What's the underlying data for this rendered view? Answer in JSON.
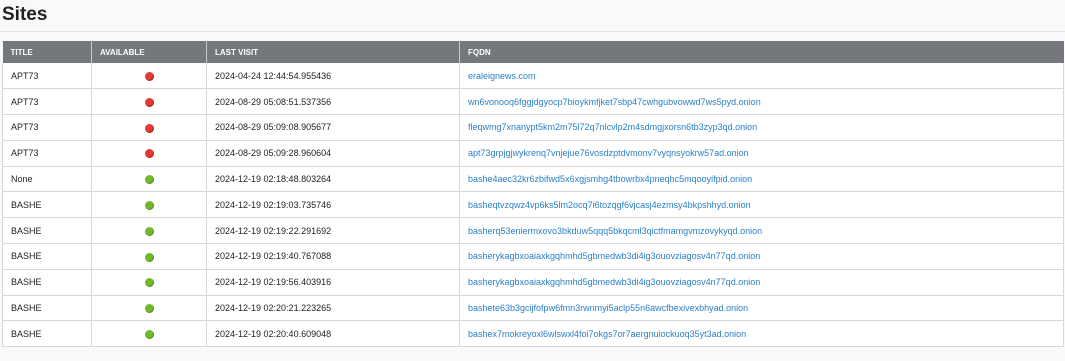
{
  "page": {
    "title": "Sites"
  },
  "table": {
    "columns": [
      "TITLE",
      "AVAILABLE",
      "LAST VISIT",
      "FQDN"
    ],
    "rows": [
      {
        "title": "APT73",
        "available": false,
        "last_visit": "2024-04-24 12:44:54.955436",
        "fqdn": "eraleignews.com"
      },
      {
        "title": "APT73",
        "available": false,
        "last_visit": "2024-08-29 05:08:51.537356",
        "fqdn": "wn6vonooq6fggjdgyocp7bioykmfjket7sbp47cwhgubvowwd7ws5pyd.onion"
      },
      {
        "title": "APT73",
        "available": false,
        "last_visit": "2024-08-29 05:09:08.905677",
        "fqdn": "fleqwmg7xnanypt5km2m75l72q7nlcvlp2m4sdmgjxorsn6tb3zyp3qd.onion"
      },
      {
        "title": "APT73",
        "available": false,
        "last_visit": "2024-08-29 05:09:28.960604",
        "fqdn": "apt73grpjgjwykrenq7vnjejue76vosdzptdvmonv7vyqnsyokrw57ad.onion"
      },
      {
        "title": "None",
        "available": true,
        "last_visit": "2024-12-19 02:18:48.803264",
        "fqdn": "bashe4aec32kr6zbifwd5x6xgjsmhg4tbowrbx4pneqhc5mqooyifpid.onion"
      },
      {
        "title": "BASHE",
        "available": true,
        "last_visit": "2024-12-19 02:19:03.735746",
        "fqdn": "basheqtvzqwz4vp6ks5lm2ocq7i6tozqgf6vjcasj4ezmsy4bkpshhyd.onion"
      },
      {
        "title": "BASHE",
        "available": true,
        "last_visit": "2024-12-19 02:19:22.291692",
        "fqdn": "basherq53eniermxovo3bkduw5qqq5bkqcml3qictfmamgvmzovykyqd.onion"
      },
      {
        "title": "BASHE",
        "available": true,
        "last_visit": "2024-12-19 02:19:40.767088",
        "fqdn": "basherykagbxoaiaxkgqhmhd5gbmedwb3di4ig3ouovziagosv4n77qd.onion"
      },
      {
        "title": "BASHE",
        "available": true,
        "last_visit": "2024-12-19 02:19:56.403916",
        "fqdn": "basherykagbxoaiaxkgqhmhd5gbmedwb3di4ig3ouovziagosv4n77qd.onion"
      },
      {
        "title": "BASHE",
        "available": true,
        "last_visit": "2024-12-19 02:20:21.223265",
        "fqdn": "bashete63b3gcijfofpw6fmn3rwnmyi5aclp55n6awcfbexivexbhyad.onion"
      },
      {
        "title": "BASHE",
        "available": true,
        "last_visit": "2024-12-19 02:20:40.609048",
        "fqdn": "bashex7mokreyoxl6wlswxl4foi7okgs7or7aergnuiockuoq35yt3ad.onion"
      }
    ]
  },
  "icons": {
    "available_true": "status-up-dot",
    "available_false": "status-down-dot"
  },
  "colors": {
    "up": "#72b82a",
    "down": "#e53935",
    "link": "#2a7fc9",
    "header": "#74777b"
  }
}
